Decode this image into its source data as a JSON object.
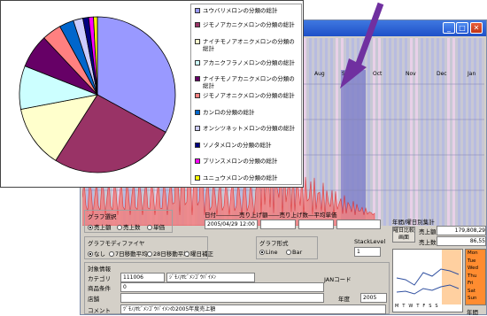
{
  "colors": {
    "titlebar": "#1e50c8",
    "pie_outline": "#000000"
  },
  "app": {
    "months": [
      "Aug",
      "Sep",
      "Oct",
      "Nov",
      "Dec",
      "Jan"
    ],
    "window_buttons": [
      "_",
      "□",
      "✕"
    ],
    "graph_select": {
      "title": "グラフ選択",
      "options": [
        "売上額",
        "売上数",
        "単価"
      ],
      "selected": 0
    },
    "modifier": {
      "title": "グラフモディファイヤ",
      "options": [
        "なし",
        "7日移動平均",
        "28日移動平均",
        "曜日補正"
      ],
      "selected": 0
    },
    "format": {
      "title": "グラフ形式",
      "options": [
        "Line",
        "Bar"
      ],
      "selected": 0
    },
    "stack_level_label": "StackLevel",
    "stack_level_value": "1",
    "date_header": "日付――――売り上げ額――売り上げ数―平均単価",
    "date_value": "2005/04/29 12:00",
    "info": {
      "title": "対象情報",
      "category_label": "カテゴリ",
      "category_code": "111006",
      "category_name": "ｼﾞﾓﾉ/ｵﾋﾞﾒﾝｺﾞｳﾊﾞｲﾒﾝ",
      "jan_label": "JANコード",
      "product_label": "商品条件",
      "product_value": "0",
      "store_label": "店舗",
      "year_label": "年度",
      "year_value": "2005",
      "comment_label": "コメント",
      "comment_value": "ﾂﾞﾓﾉ/ｵﾋﾞﾒﾝｺﾞｳﾊﾞｲﾒﾝの2005年度売上額"
    },
    "stats": {
      "title": "年間/曜日別集計",
      "button_label": "曜日比較画面",
      "row1_label": "売上額",
      "row1_value": "179,808,29",
      "row2_label": "売上数",
      "row2_value": "86,55"
    },
    "weekdays": [
      "Mon",
      "Tue",
      "Wed",
      "Thu",
      "Fri",
      "Sat",
      "Sun"
    ],
    "weekday_footer": "年間",
    "weekday_axis": [
      "M",
      "T",
      "W",
      "T",
      "F",
      "S",
      "S"
    ]
  },
  "chart_data": {
    "type": "pie",
    "series": [
      {
        "name": "ユウバリメロンの分類の総計",
        "value": 33,
        "color": "#9999ff"
      },
      {
        "name": "ジモノアカニクメロンの分類の総計",
        "value": 26,
        "color": "#993366"
      },
      {
        "name": "ナイチモノアオニクメロンの分類の総計",
        "value": 13,
        "color": "#ffffcc"
      },
      {
        "name": "アカニクフラノメロンの分類の総計",
        "value": 9,
        "color": "#ccffff"
      },
      {
        "name": "ナイチモノアカニクメロンの分類の総計",
        "value": 7,
        "color": "#660066"
      },
      {
        "name": "ジモノアオニクメロンの分類の総計",
        "value": 4,
        "color": "#ff8080"
      },
      {
        "name": "カンロの分類の総計",
        "value": 3,
        "color": "#0066cc"
      },
      {
        "name": "オンシツネットメロンの分類の総計",
        "value": 2,
        "color": "#ccccff"
      },
      {
        "name": "ソノタメロンの分類の総計",
        "value": 1.2,
        "color": "#000080"
      },
      {
        "name": "プリンスメロンの分類の総計",
        "value": 1,
        "color": "#ff00ff"
      },
      {
        "name": "ユニュウメロンの分類の総計",
        "value": 0.8,
        "color": "#ffff00"
      }
    ]
  }
}
